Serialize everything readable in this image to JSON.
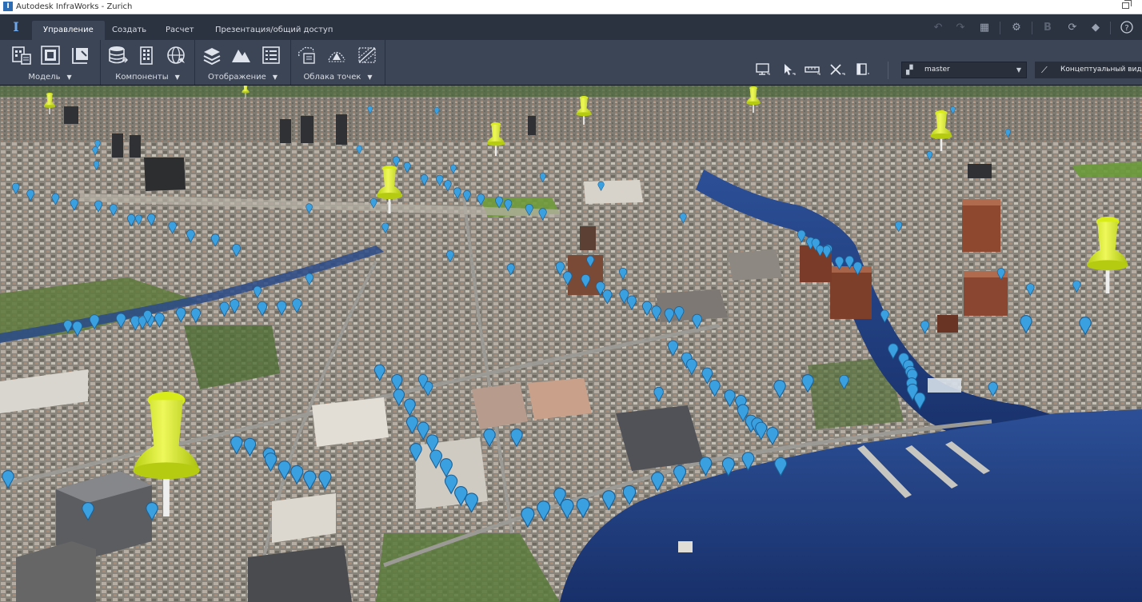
{
  "window": {
    "title": "Autodesk InfraWorks - Zurich"
  },
  "menu": {
    "tabs": [
      {
        "label": "Управление",
        "active": true
      },
      {
        "label": "Создать",
        "active": false
      },
      {
        "label": "Расчет",
        "active": false
      },
      {
        "label": "Презентация/общий доступ",
        "active": false
      }
    ],
    "quick_icons": [
      "undo-icon",
      "redo-icon",
      "model-layout-icon",
      "settings-icon",
      "bim-b-icon",
      "sync-icon",
      "cube-icon",
      "help-icon"
    ]
  },
  "ribbon": {
    "groups": [
      {
        "label": "Модель",
        "icons": [
          "model-properties-icon",
          "model-view-icon",
          "model-book-icon"
        ]
      },
      {
        "label": "Компоненты",
        "icons": [
          "data-sources-icon",
          "building-icon",
          "globe-icon"
        ]
      },
      {
        "label": "Отображение",
        "icons": [
          "layers-icon",
          "terrain-icon",
          "list-icon"
        ]
      },
      {
        "label": "Облака точек",
        "icons": [
          "point-cloud-list-icon",
          "point-cloud-scan-icon",
          "point-cloud-mesh-icon"
        ]
      }
    ],
    "view_tools": [
      "screen-icon",
      "pointer-icon",
      "measure-icon",
      "cross-tool-icon",
      "panel-icon"
    ],
    "proposal": {
      "value": "master",
      "icon": "proposal-icon"
    },
    "visual_style": {
      "label": "Концептуальный вид",
      "icon": "visual-style-icon"
    }
  },
  "colors": {
    "ui_dark": "#2b3240",
    "ribbon": "#3b4556",
    "water": "#1d3a78",
    "pushpin": "#d8ec1a",
    "poi_marker": "#3aa0e0"
  }
}
